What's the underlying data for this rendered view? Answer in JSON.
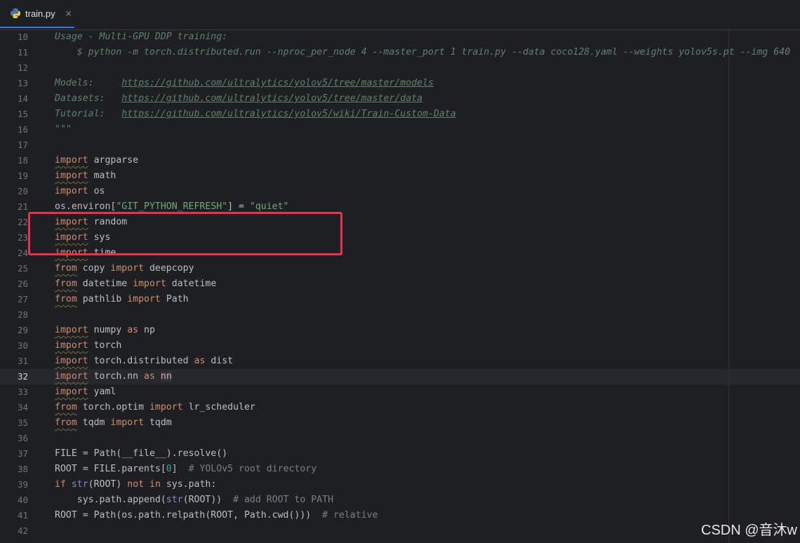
{
  "tab": {
    "label": "train.py",
    "close": "×"
  },
  "lines": [
    {
      "n": "10",
      "segs": [
        {
          "t": "Usage - Multi-GPU DDP training:",
          "c": "doc"
        }
      ]
    },
    {
      "n": "11",
      "segs": [
        {
          "t": "    $ python -m torch.distributed.run --nproc_per_node 4 --master_port 1 train.py --data coco128.yaml --weights yolov5s.pt --img 640",
          "c": "doc"
        }
      ]
    },
    {
      "n": "12",
      "segs": []
    },
    {
      "n": "13",
      "segs": [
        {
          "t": "Models:     ",
          "c": "doc"
        },
        {
          "t": "https://github.com/ultralytics/yolov5/tree/master/models",
          "c": "link"
        }
      ]
    },
    {
      "n": "14",
      "segs": [
        {
          "t": "Datasets:   ",
          "c": "doc"
        },
        {
          "t": "https://github.com/ultralytics/yolov5/tree/master/data",
          "c": "link"
        }
      ]
    },
    {
      "n": "15",
      "segs": [
        {
          "t": "Tutorial:   ",
          "c": "doc"
        },
        {
          "t": "https://github.com/ultralytics/yolov5/wiki/Train-Custom-Data",
          "c": "link"
        }
      ]
    },
    {
      "n": "16",
      "segs": [
        {
          "t": "\"\"\"",
          "c": "doc"
        }
      ]
    },
    {
      "n": "17",
      "segs": []
    },
    {
      "n": "18",
      "segs": [
        {
          "t": "import",
          "c": "kw"
        },
        {
          "t": " argparse",
          "c": ""
        }
      ]
    },
    {
      "n": "19",
      "segs": [
        {
          "t": "import",
          "c": "kw"
        },
        {
          "t": " math",
          "c": ""
        }
      ]
    },
    {
      "n": "20",
      "segs": [
        {
          "t": "import",
          "c": "kw2"
        },
        {
          "t": " os",
          "c": ""
        }
      ]
    },
    {
      "n": "21",
      "segs": [
        {
          "t": "os.environ[",
          "c": ""
        },
        {
          "t": "\"GIT_PYTHON_REFRESH\"",
          "c": "str"
        },
        {
          "t": "] = ",
          "c": ""
        },
        {
          "t": "\"quiet\"",
          "c": "str"
        }
      ]
    },
    {
      "n": "22",
      "segs": [
        {
          "t": "import",
          "c": "kw"
        },
        {
          "t": " random",
          "c": ""
        }
      ]
    },
    {
      "n": "23",
      "segs": [
        {
          "t": "import",
          "c": "kw"
        },
        {
          "t": " sys",
          "c": ""
        }
      ]
    },
    {
      "n": "24",
      "segs": [
        {
          "t": "import",
          "c": "kw"
        },
        {
          "t": " time",
          "c": ""
        }
      ]
    },
    {
      "n": "25",
      "segs": [
        {
          "t": "from",
          "c": "kw"
        },
        {
          "t": " copy ",
          "c": ""
        },
        {
          "t": "import",
          "c": "kw2"
        },
        {
          "t": " deepcopy",
          "c": ""
        }
      ]
    },
    {
      "n": "26",
      "segs": [
        {
          "t": "from",
          "c": "kw"
        },
        {
          "t": " datetime ",
          "c": ""
        },
        {
          "t": "import",
          "c": "kw2"
        },
        {
          "t": " datetime",
          "c": ""
        }
      ]
    },
    {
      "n": "27",
      "segs": [
        {
          "t": "from",
          "c": "kw"
        },
        {
          "t": " pathlib ",
          "c": ""
        },
        {
          "t": "import",
          "c": "kw2"
        },
        {
          "t": " Path",
          "c": ""
        }
      ]
    },
    {
      "n": "28",
      "segs": []
    },
    {
      "n": "29",
      "segs": [
        {
          "t": "import",
          "c": "kw"
        },
        {
          "t": " numpy ",
          "c": ""
        },
        {
          "t": "as",
          "c": "kw2"
        },
        {
          "t": " np",
          "c": ""
        }
      ]
    },
    {
      "n": "30",
      "segs": [
        {
          "t": "import",
          "c": "kw"
        },
        {
          "t": " torch",
          "c": ""
        }
      ]
    },
    {
      "n": "31",
      "segs": [
        {
          "t": "import",
          "c": "kw"
        },
        {
          "t": " torch.distributed ",
          "c": ""
        },
        {
          "t": "as",
          "c": "kw2"
        },
        {
          "t": " dist",
          "c": ""
        }
      ]
    },
    {
      "n": "32",
      "segs": [
        {
          "t": "import",
          "c": "kw"
        },
        {
          "t": " torch.nn ",
          "c": ""
        },
        {
          "t": "as",
          "c": "kw2"
        },
        {
          "t": " ",
          "c": ""
        },
        {
          "t": "nn",
          "c": "hl"
        }
      ],
      "current": true
    },
    {
      "n": "33",
      "segs": [
        {
          "t": "import",
          "c": "kw"
        },
        {
          "t": " yaml",
          "c": ""
        }
      ]
    },
    {
      "n": "34",
      "segs": [
        {
          "t": "from",
          "c": "kw"
        },
        {
          "t": " torch.optim ",
          "c": ""
        },
        {
          "t": "import",
          "c": "kw2"
        },
        {
          "t": " lr_scheduler",
          "c": ""
        }
      ]
    },
    {
      "n": "35",
      "segs": [
        {
          "t": "from",
          "c": "kw"
        },
        {
          "t": " tqdm ",
          "c": ""
        },
        {
          "t": "import",
          "c": "kw2"
        },
        {
          "t": " tqdm",
          "c": ""
        }
      ]
    },
    {
      "n": "36",
      "segs": []
    },
    {
      "n": "37",
      "segs": [
        {
          "t": "FILE = Path(__file__).resolve()",
          "c": ""
        }
      ]
    },
    {
      "n": "38",
      "segs": [
        {
          "t": "ROOT = FILE.parents[",
          "c": ""
        },
        {
          "t": "0",
          "c": "num"
        },
        {
          "t": "]  ",
          "c": ""
        },
        {
          "t": "# YOLOv5 root directory",
          "c": "cmt"
        }
      ]
    },
    {
      "n": "39",
      "segs": [
        {
          "t": "if",
          "c": "kw2"
        },
        {
          "t": " ",
          "c": ""
        },
        {
          "t": "str",
          "c": "bi"
        },
        {
          "t": "(ROOT) ",
          "c": ""
        },
        {
          "t": "not in",
          "c": "kw2"
        },
        {
          "t": " sys.path:",
          "c": ""
        }
      ]
    },
    {
      "n": "40",
      "segs": [
        {
          "t": "    sys.path.append(",
          "c": ""
        },
        {
          "t": "str",
          "c": "bi"
        },
        {
          "t": "(ROOT))  ",
          "c": ""
        },
        {
          "t": "# add ROOT to PATH",
          "c": "cmt"
        }
      ]
    },
    {
      "n": "41",
      "segs": [
        {
          "t": "ROOT = Path(os.path.relpath(ROOT, Path.cwd()))  ",
          "c": ""
        },
        {
          "t": "# relative",
          "c": "cmt"
        }
      ]
    },
    {
      "n": "42",
      "segs": []
    }
  ],
  "watermark": "CSDN @音沐w"
}
